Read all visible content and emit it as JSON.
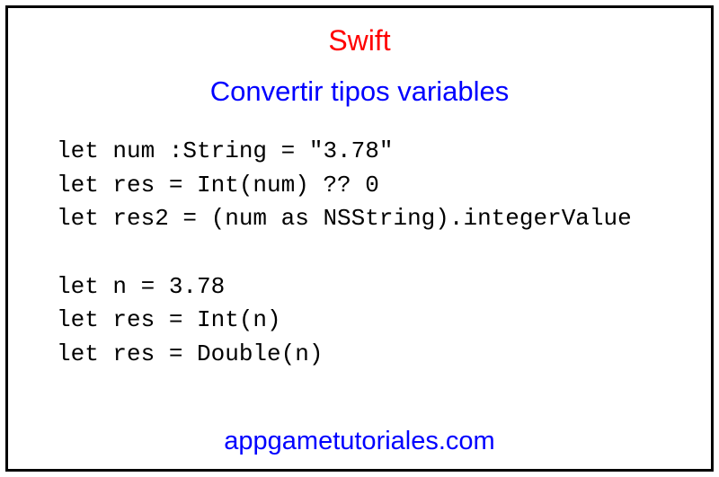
{
  "title": "Swift",
  "subtitle": "Convertir tipos variables",
  "code": {
    "lines": [
      "let num :String = \"3.78\"",
      "let res = Int(num) ?? 0",
      "let res2 = (num as NSString).integerValue",
      "",
      "let n = 3.78",
      "let res = Int(n)",
      "let res = Double(n)"
    ]
  },
  "footer": "appgametutoriales.com"
}
